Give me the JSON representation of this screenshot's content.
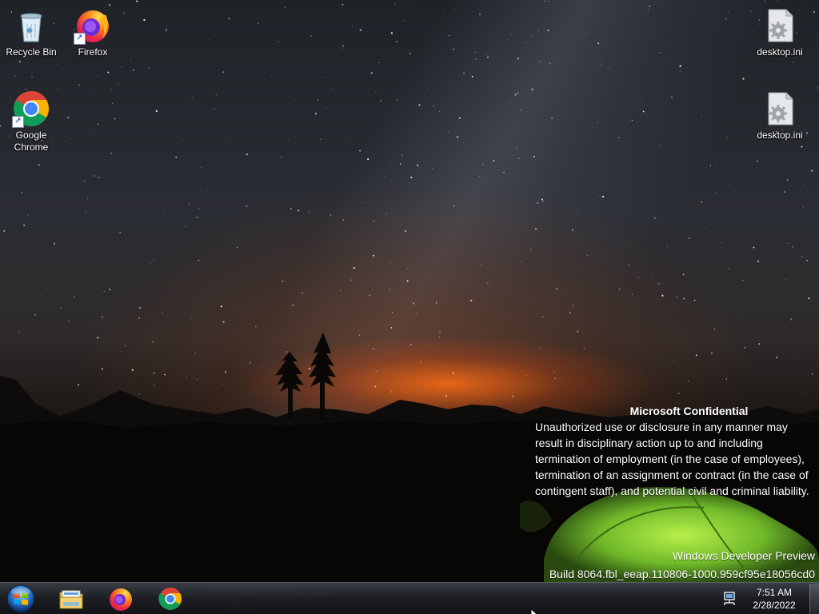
{
  "desktop": {
    "icons": [
      {
        "label": "Recycle Bin",
        "icon": "recycle-bin-icon"
      },
      {
        "label": "Firefox",
        "icon": "firefox-icon"
      },
      {
        "label": "Google Chrome",
        "icon": "chrome-icon"
      },
      {
        "label": "desktop.ini",
        "icon": "settings-file-icon"
      },
      {
        "label": "desktop.ini",
        "icon": "settings-file-icon"
      }
    ]
  },
  "watermark": {
    "title": "Microsoft Confidential",
    "body": "Unauthorized use or disclosure in any manner may result in disciplinary action up to and including termination of employment (in the case of employees), termination of an assignment or contract (in the case of contingent staff), and potential civil and criminal liability.",
    "edition": "Windows Developer Preview",
    "build": "Build 8064.fbl_eeap.110806-1000.959cf95e18056cd0"
  },
  "taskbar": {
    "start": "start-orb-icon",
    "pinned": [
      "file-explorer-icon",
      "firefox-icon",
      "chrome-icon"
    ],
    "tray_icon": "network-icon",
    "clock": {
      "time": "7:51 AM",
      "date": "2/28/2022"
    }
  },
  "colors": {
    "taskbar": "#1c1e24",
    "sky_glow": "#ff6e14",
    "tent": "#8fd13a"
  }
}
